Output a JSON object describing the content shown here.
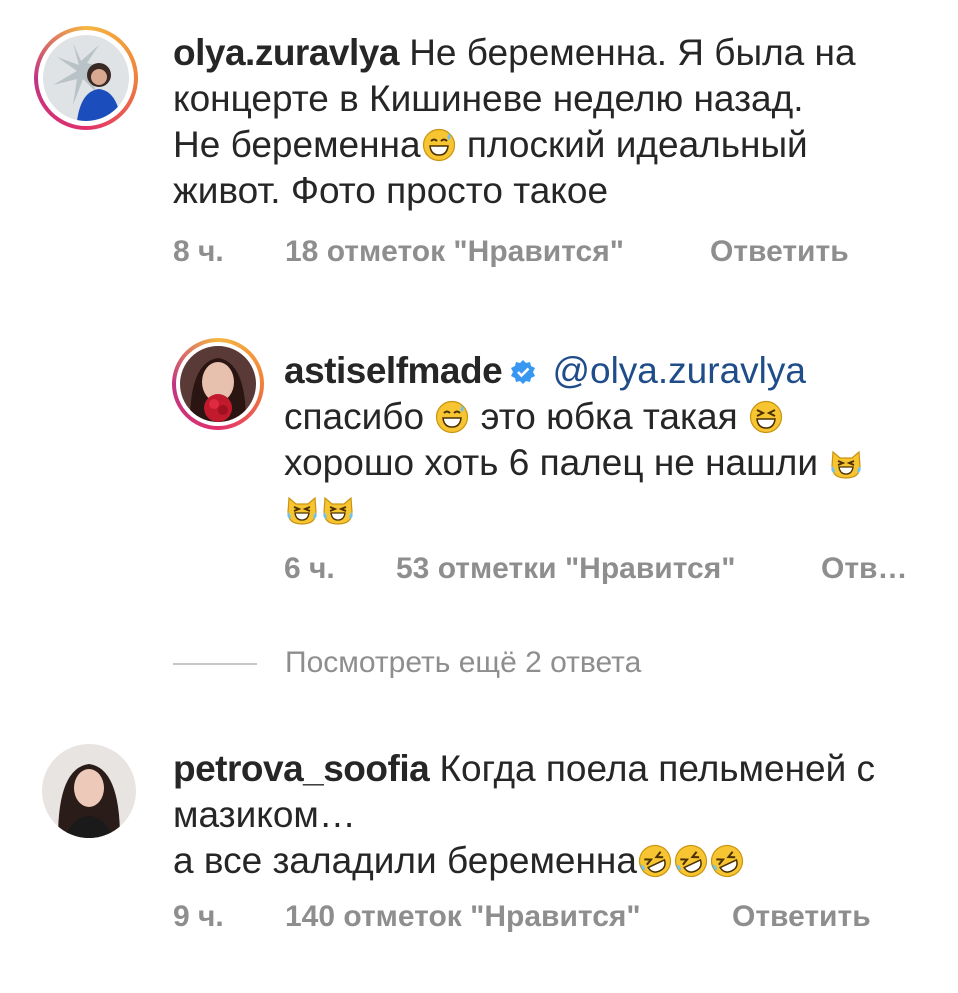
{
  "comments": [
    {
      "username": "olya.zuravlya",
      "line1": "Не беременна. Я была на",
      "line2": "концерте в Кишиневе неделю назад.",
      "line3a": "Не беременна",
      "line3b": " плоский идеальный",
      "line4": "живот. Фото просто такое",
      "time": "8 ч.",
      "likes": "18 отметок \"Нравится\"",
      "reply": "Ответить",
      "avatar_icon": "profile-photo"
    },
    {
      "username": "astiselfmade",
      "mention": "@olya.zuravlya",
      "line2a": "спасибо ",
      "line2b": " это юбка такая ",
      "line3": "хорошо хоть 6 палец не нашли ",
      "time": "6 ч.",
      "likes": "53 отметки \"Нравится\"",
      "reply": "Отв…",
      "avatar_icon": "profile-photo"
    },
    {
      "username": "petrova_soofia",
      "line1": "Когда поела пельменей с",
      "line2": "мазиком…",
      "line3": "а все заладили беременна",
      "time": "9 ч.",
      "likes": "140 отметок \"Нравится\"",
      "reply": "Ответить",
      "avatar_icon": "profile-photo"
    }
  ],
  "view_more": "Посмотреть ещё 2 ответа",
  "icons": {
    "verified": "verified-badge-icon",
    "grinning_sweat": "grinning-sweat-emoji",
    "squinting": "squinting-face-emoji",
    "cat_tears": "cat-tears-of-joy-emoji",
    "rofl": "rolling-laughing-emoji"
  },
  "colors": {
    "text": "#262626",
    "meta": "#8e8e8e",
    "mention": "#1f4d8a",
    "verified": "#3897f0"
  }
}
